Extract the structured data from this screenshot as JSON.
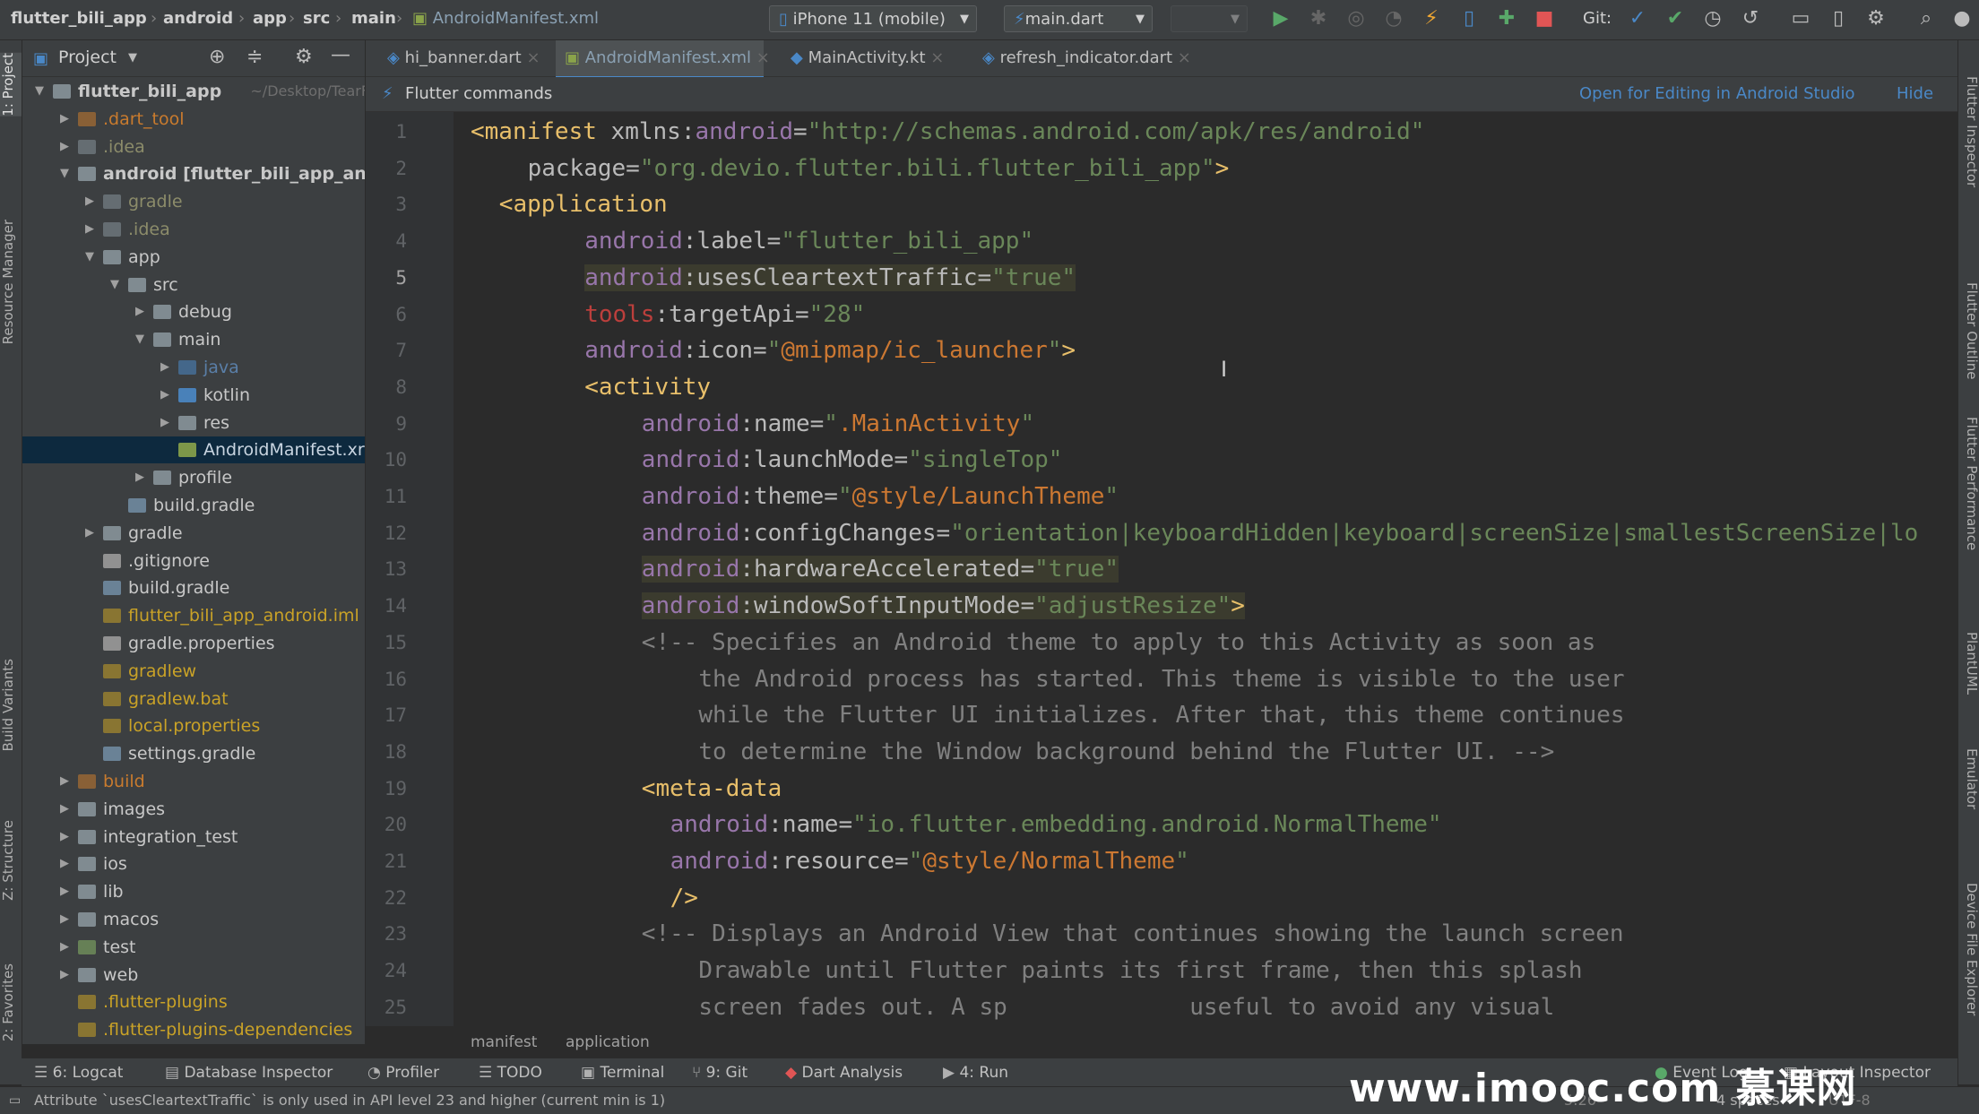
{
  "navbar": {
    "crumbs": [
      "flutter_bili_app",
      "android",
      "app",
      "src",
      "main",
      "AndroidManifest.xml"
    ],
    "device": "iPhone 11 (mobile)",
    "run_config": "main.dart",
    "git_label": "Git:"
  },
  "left_strip": [
    "1: Project",
    "Resource Manager",
    "Build Variants",
    "Z: Structure",
    "2: Favorites"
  ],
  "right_strip": [
    "Flutter Inspector",
    "Flutter Outline",
    "Flutter Performance",
    "PlantUML",
    "Emulator",
    "Device File Explorer"
  ],
  "project": {
    "title": "Project",
    "tree": [
      {
        "label": "flutter_bili_app",
        "extra": "~/Desktop/TearF",
        "depth": 0,
        "arrow": "down",
        "color": "#87939a",
        "bold": true
      },
      {
        "label": ".dart_tool",
        "depth": 1,
        "arrow": "right",
        "color": "#c97b2e",
        "dim": true
      },
      {
        "label": ".idea",
        "depth": 1,
        "arrow": "right",
        "color": "#87939a",
        "dim": true
      },
      {
        "label": "android [flutter_bili_app_andr",
        "depth": 1,
        "arrow": "down",
        "color": "#87939a",
        "bold": true
      },
      {
        "label": "gradle",
        "depth": 2,
        "arrow": "right",
        "color": "#87939a",
        "dim": true
      },
      {
        "label": ".idea",
        "depth": 2,
        "arrow": "right",
        "color": "#87939a",
        "dim": true
      },
      {
        "label": "app",
        "depth": 2,
        "arrow": "down",
        "color": "#87939a"
      },
      {
        "label": "src",
        "depth": 3,
        "arrow": "down",
        "color": "#87939a"
      },
      {
        "label": "debug",
        "depth": 4,
        "arrow": "right",
        "color": "#87939a"
      },
      {
        "label": "main",
        "depth": 4,
        "arrow": "down",
        "color": "#87939a"
      },
      {
        "label": "java",
        "depth": 5,
        "arrow": "right",
        "color": "#4a88c7",
        "dim": true
      },
      {
        "label": "kotlin",
        "depth": 5,
        "arrow": "right",
        "color": "#4a88c7"
      },
      {
        "label": "res",
        "depth": 5,
        "arrow": "right",
        "color": "#87939a"
      },
      {
        "label": "AndroidManifest.xr",
        "depth": 5,
        "arrow": "none",
        "color": "#8aa34a",
        "selected": true
      },
      {
        "label": "profile",
        "depth": 4,
        "arrow": "right",
        "color": "#87939a"
      },
      {
        "label": "build.gradle",
        "depth": 3,
        "arrow": "none",
        "color": "#6f8aa0"
      },
      {
        "label": "gradle",
        "depth": 2,
        "arrow": "right",
        "color": "#87939a"
      },
      {
        "label": ".gitignore",
        "depth": 2,
        "arrow": "none",
        "color": "#9a9a9a"
      },
      {
        "label": "build.gradle",
        "depth": 2,
        "arrow": "none",
        "color": "#6f8aa0"
      },
      {
        "label": "flutter_bili_app_android.iml",
        "depth": 2,
        "arrow": "none",
        "color": "#c9a227",
        "dim": true
      },
      {
        "label": "gradle.properties",
        "depth": 2,
        "arrow": "none",
        "color": "#9a9a9a"
      },
      {
        "label": "gradlew",
        "depth": 2,
        "arrow": "none",
        "color": "#c9a227",
        "dim": true
      },
      {
        "label": "gradlew.bat",
        "depth": 2,
        "arrow": "none",
        "color": "#c9a227",
        "dim": true
      },
      {
        "label": "local.properties",
        "depth": 2,
        "arrow": "none",
        "color": "#c9a227",
        "dim": true
      },
      {
        "label": "settings.gradle",
        "depth": 2,
        "arrow": "none",
        "color": "#6f8aa0"
      },
      {
        "label": "build",
        "depth": 1,
        "arrow": "right",
        "color": "#c97b2e",
        "dim": true
      },
      {
        "label": "images",
        "depth": 1,
        "arrow": "right",
        "color": "#87939a"
      },
      {
        "label": "integration_test",
        "depth": 1,
        "arrow": "right",
        "color": "#87939a"
      },
      {
        "label": "ios",
        "depth": 1,
        "arrow": "right",
        "color": "#87939a"
      },
      {
        "label": "lib",
        "depth": 1,
        "arrow": "right",
        "color": "#87939a"
      },
      {
        "label": "macos",
        "depth": 1,
        "arrow": "right",
        "color": "#87939a"
      },
      {
        "label": "test",
        "depth": 1,
        "arrow": "right",
        "color": "#6a8759"
      },
      {
        "label": "web",
        "depth": 1,
        "arrow": "right",
        "color": "#87939a"
      },
      {
        "label": ".flutter-plugins",
        "depth": 1,
        "arrow": "none",
        "color": "#c9a227",
        "dim": true
      },
      {
        "label": ".flutter-plugins-dependencies",
        "depth": 1,
        "arrow": "none",
        "color": "#c9a227",
        "dim": true
      }
    ]
  },
  "tabs": [
    {
      "label": "hi_banner.dart",
      "active": false
    },
    {
      "label": "AndroidManifest.xml",
      "active": true
    },
    {
      "label": "MainActivity.kt",
      "active": false
    },
    {
      "label": "refresh_indicator.dart",
      "active": false
    }
  ],
  "flutter_bar": {
    "title": "Flutter commands",
    "open_link": "Open for Editing in Android Studio",
    "hide_link": "Hide"
  },
  "code_lines": [
    {
      "n": "1",
      "indent": 0,
      "parts": [
        [
          "tag",
          "<manifest "
        ],
        [
          "attr",
          "xmlns:"
        ],
        [
          "ns",
          "android"
        ],
        [
          "attr",
          "="
        ],
        [
          "val",
          "\"http://schemas.android.com/apk/res/android\""
        ]
      ]
    },
    {
      "n": "2",
      "indent": 2,
      "parts": [
        [
          "attr",
          "package="
        ],
        [
          "val",
          "\"org.devio.flutter.bili.flutter_bili_app\""
        ],
        [
          "tag",
          ">"
        ]
      ]
    },
    {
      "n": "3",
      "indent": 1,
      "parts": [
        [
          "tag",
          "<application"
        ]
      ]
    },
    {
      "n": "4",
      "indent": 4,
      "parts": [
        [
          "ns",
          "android"
        ],
        [
          "attr",
          ":label="
        ],
        [
          "val",
          "\"flutter_bili_app\""
        ]
      ]
    },
    {
      "n": "5",
      "indent": 4,
      "hl": true,
      "parts": [
        [
          "ns",
          "android"
        ],
        [
          "attr",
          ":usesCleartextTraffic="
        ],
        [
          "val",
          "\"true\""
        ]
      ]
    },
    {
      "n": "6",
      "indent": 4,
      "parts": [
        [
          "bad",
          "tools"
        ],
        [
          "attr",
          ":targetApi="
        ],
        [
          "val",
          "\"28\""
        ]
      ]
    },
    {
      "n": "7",
      "indent": 4,
      "parts": [
        [
          "ns",
          "android"
        ],
        [
          "attr",
          ":icon="
        ],
        [
          "val",
          "\""
        ],
        [
          "ref",
          "@mipmap/ic_launcher"
        ],
        [
          "val",
          "\""
        ],
        [
          "tag",
          ">"
        ]
      ]
    },
    {
      "n": "8",
      "indent": 4,
      "parts": [
        [
          "tag",
          "<activity"
        ]
      ]
    },
    {
      "n": "9",
      "indent": 6,
      "parts": [
        [
          "ns",
          "android"
        ],
        [
          "attr",
          ":name="
        ],
        [
          "val",
          "\""
        ],
        [
          "ref",
          ".MainActivity"
        ],
        [
          "val",
          "\""
        ]
      ]
    },
    {
      "n": "10",
      "indent": 6,
      "parts": [
        [
          "ns",
          "android"
        ],
        [
          "attr",
          ":launchMode="
        ],
        [
          "val",
          "\"singleTop\""
        ]
      ]
    },
    {
      "n": "11",
      "indent": 6,
      "parts": [
        [
          "ns",
          "android"
        ],
        [
          "attr",
          ":theme="
        ],
        [
          "val",
          "\""
        ],
        [
          "ref",
          "@style/LaunchTheme"
        ],
        [
          "val",
          "\""
        ]
      ]
    },
    {
      "n": "12",
      "indent": 6,
      "parts": [
        [
          "ns",
          "android"
        ],
        [
          "attr",
          ":configChanges="
        ],
        [
          "val",
          "\"orientation|keyboardHidden|keyboard|screenSize|smallestScreenSize|lo"
        ]
      ]
    },
    {
      "n": "13",
      "indent": 6,
      "hl": true,
      "parts": [
        [
          "ns",
          "android"
        ],
        [
          "attr",
          ":hardwareAccelerated="
        ],
        [
          "val",
          "\"true\""
        ]
      ]
    },
    {
      "n": "14",
      "indent": 6,
      "hl": true,
      "parts": [
        [
          "ns",
          "android"
        ],
        [
          "attr",
          ":windowSoftInputMode="
        ],
        [
          "val",
          "\"adjustResize\""
        ],
        [
          "tag",
          ">"
        ]
      ]
    },
    {
      "n": "15",
      "indent": 6,
      "parts": [
        [
          "cmt",
          "<!-- Specifies an Android theme to apply to this Activity as soon as"
        ]
      ]
    },
    {
      "n": "16",
      "indent": 8,
      "parts": [
        [
          "cmt",
          "the Android process has started. This theme is visible to the user"
        ]
      ]
    },
    {
      "n": "17",
      "indent": 8,
      "parts": [
        [
          "cmt",
          "while the Flutter UI initializes. After that, this theme continues"
        ]
      ]
    },
    {
      "n": "18",
      "indent": 8,
      "parts": [
        [
          "cmt",
          "to determine the Window background behind the Flutter UI. -->"
        ]
      ]
    },
    {
      "n": "19",
      "indent": 6,
      "parts": [
        [
          "tag",
          "<meta-data"
        ]
      ]
    },
    {
      "n": "20",
      "indent": 7,
      "parts": [
        [
          "ns",
          "android"
        ],
        [
          "attr",
          ":name="
        ],
        [
          "val",
          "\"io.flutter.embedding.android.NormalTheme\""
        ]
      ]
    },
    {
      "n": "21",
      "indent": 7,
      "parts": [
        [
          "ns",
          "android"
        ],
        [
          "attr",
          ":resource="
        ],
        [
          "val",
          "\""
        ],
        [
          "ref",
          "@style/NormalTheme"
        ],
        [
          "val",
          "\""
        ]
      ]
    },
    {
      "n": "22",
      "indent": 7,
      "parts": [
        [
          "tag",
          "/>"
        ]
      ]
    },
    {
      "n": "23",
      "indent": 6,
      "parts": [
        [
          "cmt",
          "<!-- Displays an Android View that continues showing the launch screen"
        ]
      ]
    },
    {
      "n": "24",
      "indent": 8,
      "parts": [
        [
          "cmt",
          "Drawable until Flutter paints its first frame, then this splash"
        ]
      ]
    },
    {
      "n": "25",
      "indent": 8,
      "parts": [
        [
          "cmt",
          "screen fades out. A sp"
        ],
        [
          "cmt",
          "             useful to avoid any visual"
        ]
      ]
    }
  ],
  "editor_breadcrumb": [
    "manifest",
    "application"
  ],
  "bottom_tabs": [
    {
      "label": "6: Logcat",
      "icon": "logcat-icon",
      "glyph": "☰"
    },
    {
      "label": "Database Inspector",
      "icon": "database-icon",
      "glyph": "▤"
    },
    {
      "label": "Profiler",
      "icon": "profiler-icon",
      "glyph": "◔"
    },
    {
      "label": "TODO",
      "icon": "todo-icon",
      "glyph": "☰"
    },
    {
      "label": "Terminal",
      "icon": "terminal-icon",
      "glyph": "▣"
    },
    {
      "label": "9: Git",
      "icon": "git-icon",
      "glyph": "⑂"
    },
    {
      "label": "Dart Analysis",
      "icon": "dart-analysis-icon",
      "glyph": "◆"
    },
    {
      "label": "4: Run",
      "icon": "run-icon",
      "glyph": "▶"
    },
    {
      "label": "Event Log",
      "icon": "event-log-icon",
      "glyph": "●"
    },
    {
      "label": "Layout Inspector",
      "icon": "layout-inspector-icon",
      "glyph": "▦"
    }
  ],
  "status": {
    "message": "Attribute `usesCleartextTraffic` is only used in API level 23 and higher (current min is 1)",
    "position": "5:26",
    "indent": "4 spaces",
    "encoding": "UTF-8"
  },
  "watermark": "www.imooc.com 慕课网",
  "colors": {
    "accent": "#4a88c7",
    "tag": "#e8bf6a",
    "namespace": "#9876aa",
    "value": "#6a8759",
    "reference": "#cc7832",
    "comment": "#808080",
    "error": "#bc3f3c"
  }
}
